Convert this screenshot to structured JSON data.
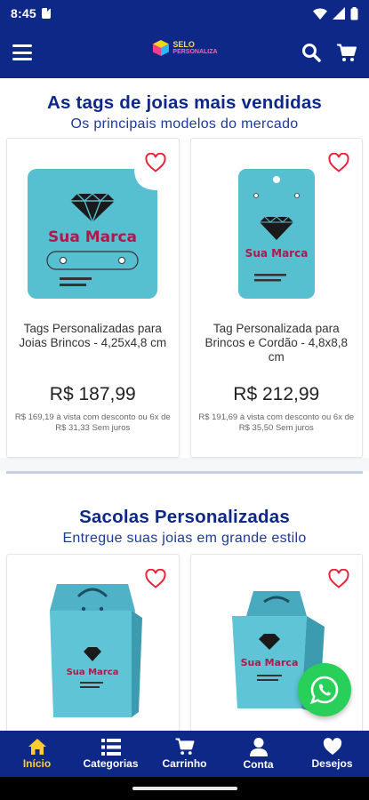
{
  "status_bar": {
    "time": "8:45"
  },
  "colors": {
    "brand_blue": "#0e2888",
    "accent_yellow": "#ffcc33",
    "heart_red": "#e8243a",
    "whatsapp_green": "#28d05a",
    "tag_teal": "#56bfd0"
  },
  "header": {
    "logo_line1": "SELO",
    "logo_line2": "PERSONALIZA"
  },
  "sections": [
    {
      "title": "As tags de joias mais vendidas",
      "subtitle": "Os principais modelos do mercado",
      "products": [
        {
          "image_label": "Sua Marca",
          "name": "Tags Personalizadas para Joias Brincos - 4,25x4,8 cm",
          "price": "R$ 187,99",
          "installments": "R$ 169,19 à vista com desconto ou 6x de R$ 31,33 Sem juros"
        },
        {
          "image_label": "Sua Marca",
          "name": "Tag Personalizada para Brincos e Cordão - 4,8x8,8 cm",
          "price": "R$ 212,99",
          "installments": "R$ 191,69 à vista com desconto ou 6x de R$ 35,50 Sem juros"
        }
      ]
    },
    {
      "title": "Sacolas Personalizadas",
      "subtitle": "Entregue suas joias em grande estilo",
      "products": [
        {
          "image_label": "Sua Marca"
        },
        {
          "image_label": "Sua Marca"
        }
      ]
    }
  ],
  "bottom_nav": [
    {
      "label": "Início",
      "icon": "home-icon",
      "active": true
    },
    {
      "label": "Categorias",
      "icon": "list-icon",
      "active": false
    },
    {
      "label": "Carrinho",
      "icon": "cart-icon",
      "active": false
    },
    {
      "label": "Conta",
      "icon": "user-icon",
      "active": false
    },
    {
      "label": "Desejos",
      "icon": "heart-icon",
      "active": false
    }
  ]
}
